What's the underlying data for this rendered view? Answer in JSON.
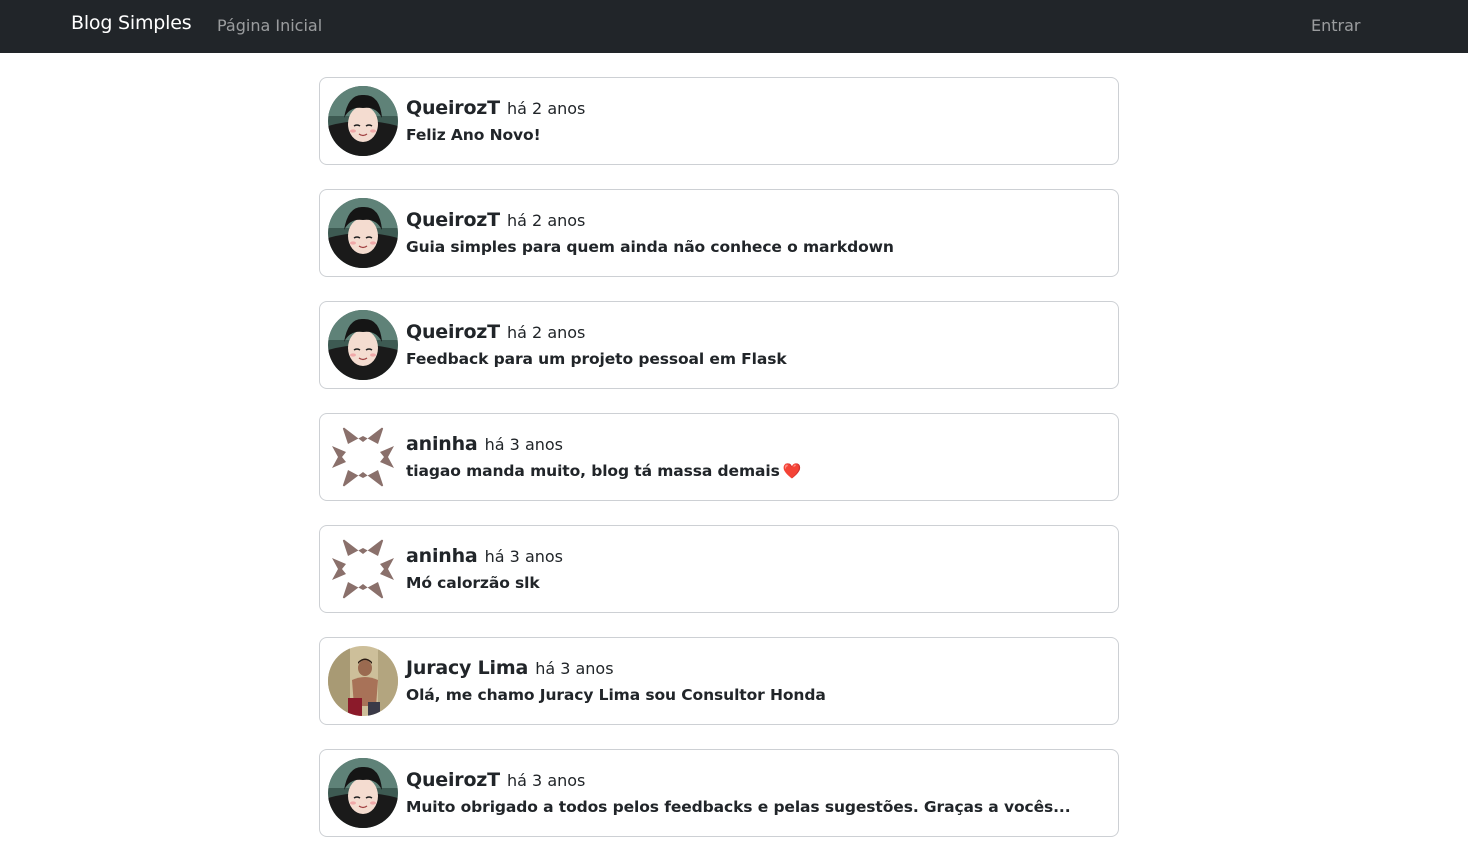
{
  "navbar": {
    "brand": "Blog Simples",
    "home_label": "Página Inicial",
    "login_label": "Entrar"
  },
  "colors": {
    "navbar_bg": "#212529",
    "card_border": "#cdd0d4",
    "heart": "#e0243a"
  },
  "posts": [
    {
      "author": "QueirozT",
      "time": "há 2 anos",
      "title": "Feliz Ano Novo!",
      "avatar": "anime-avatar-icon"
    },
    {
      "author": "QueirozT",
      "time": "há 2 anos",
      "title": "Guia simples para quem ainda não conhece o markdown",
      "avatar": "anime-avatar-icon"
    },
    {
      "author": "QueirozT",
      "time": "há 2 anos",
      "title": "Feedback para um projeto pessoal em Flask",
      "avatar": "anime-avatar-icon"
    },
    {
      "author": "aninha",
      "time": "há 3 anos",
      "title": "tiagao manda muito, blog tá massa demais",
      "title_emoji": "❤️",
      "avatar": "identicon-avatar-icon"
    },
    {
      "author": "aninha",
      "time": "há 3 anos",
      "title": "Mó calorzão slk",
      "avatar": "identicon-avatar-icon"
    },
    {
      "author": "Juracy Lima",
      "time": "há 3 anos",
      "title": "Olá, me chamo Juracy Lima sou Consultor Honda",
      "avatar": "photo-avatar-icon"
    },
    {
      "author": "QueirozT",
      "time": "há 3 anos",
      "title": "Muito obrigado a todos pelos feedbacks e pelas sugestões. Graças a vocês...",
      "avatar": "anime-avatar-icon"
    }
  ]
}
